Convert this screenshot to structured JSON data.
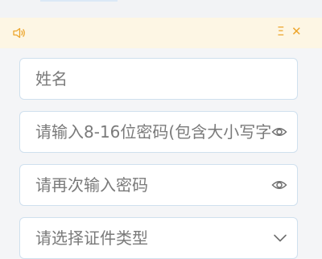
{
  "colors": {
    "notice_bg": "#fdf6e4",
    "notice_icon": "#eda62d",
    "field_border": "#cfe0ee",
    "placeholder": "#7a7a7a"
  },
  "notice_bar": {
    "left_icon": "speaker-icon",
    "right_icons": [
      "expand-icon",
      "close-icon"
    ]
  },
  "form": {
    "name_field": {
      "placeholder": "姓名"
    },
    "password_field": {
      "placeholder": "请输入8-16位密码(包含大小写字",
      "icon": "eye-icon"
    },
    "confirm_password_field": {
      "placeholder": "请再次输入密码",
      "icon": "eye-icon"
    },
    "id_type_select": {
      "placeholder": "请选择证件类型",
      "icon": "chevron-down-icon"
    }
  }
}
